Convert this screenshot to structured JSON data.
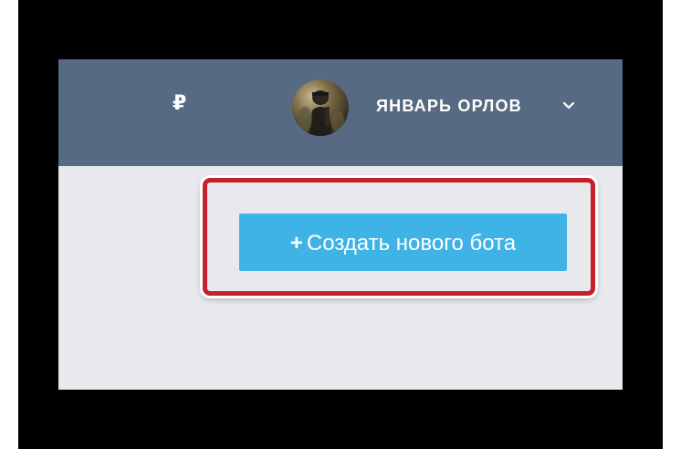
{
  "header": {
    "currency_icon": "₽",
    "user_name": "ЯНВАРЬ ОРЛОВ",
    "avatar_icon": "avatar-photo",
    "dropdown_icon": "chevron-down-icon"
  },
  "main": {
    "create_button": {
      "plus": "+",
      "label": "Создать нового бота"
    }
  },
  "colors": {
    "header_bg": "#566b83",
    "content_bg": "#e7e9ec",
    "button_bg": "#3fb3e6",
    "highlight_border": "#c8202a",
    "frame": "#000000"
  }
}
